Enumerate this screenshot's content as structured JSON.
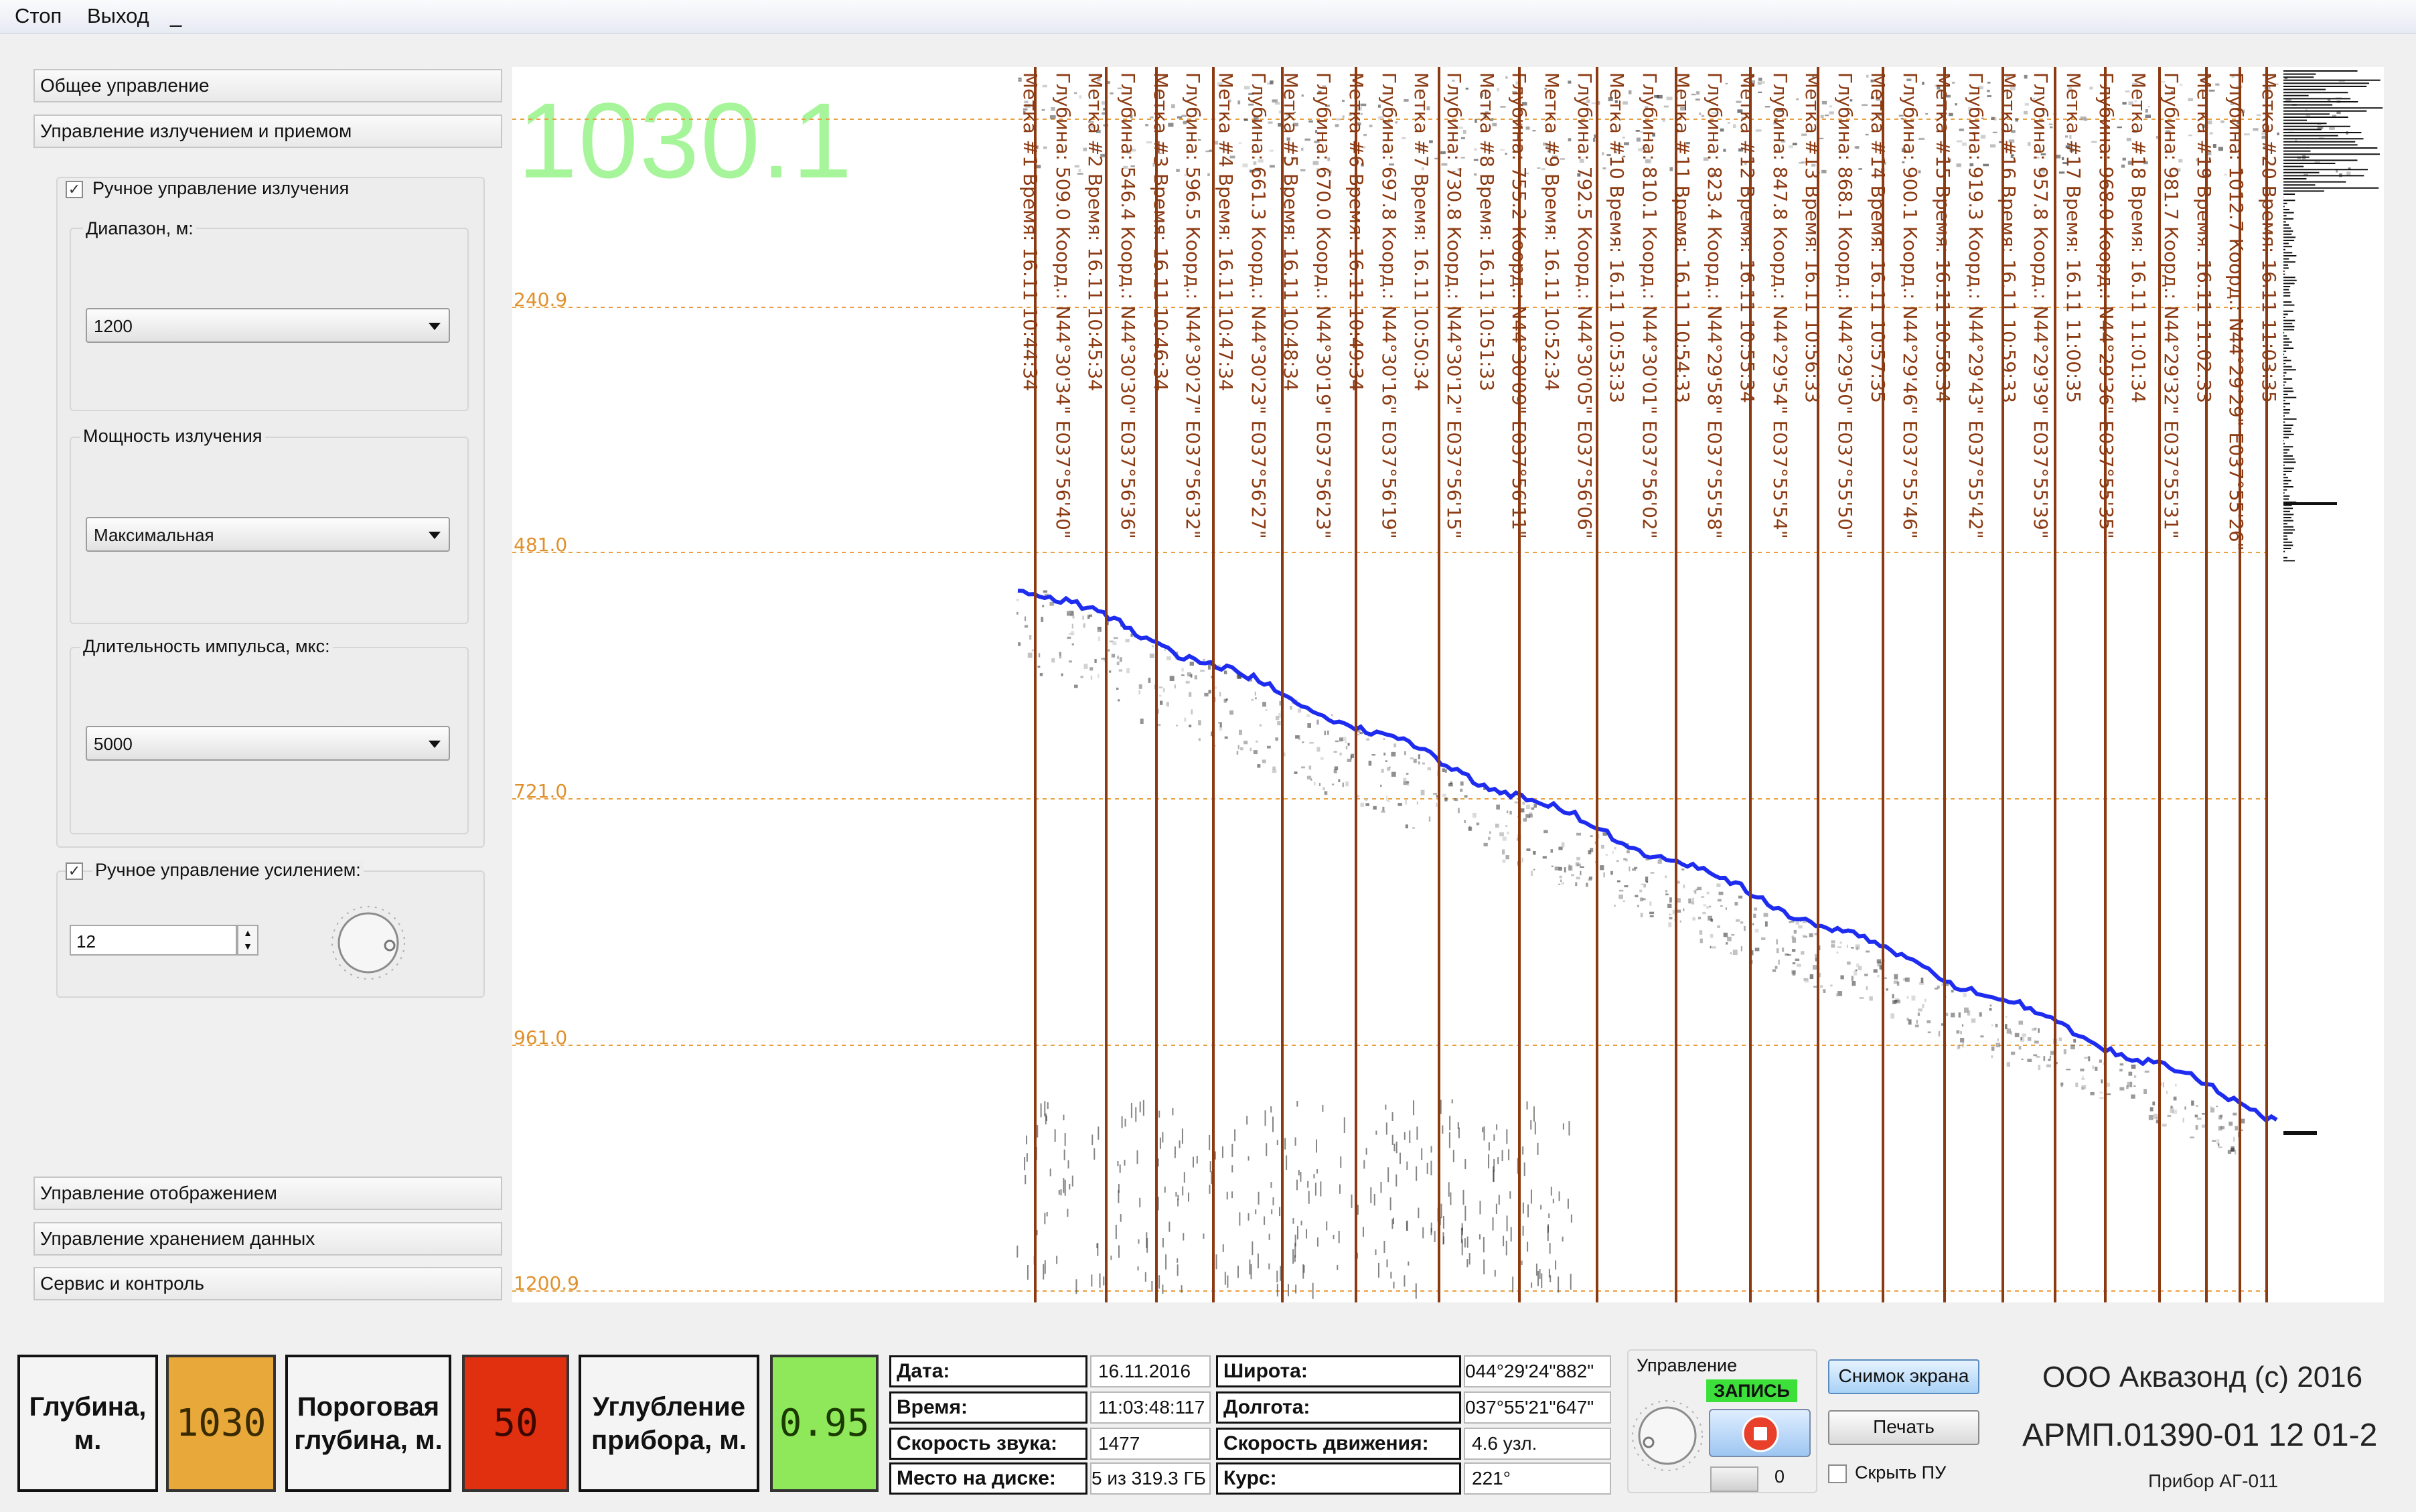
{
  "menu": {
    "stop": "Стоп",
    "exit": "Выход",
    "extra": "_"
  },
  "left_panel": {
    "general_control": "Общее управление",
    "emission_control": "Управление излучением и приемом",
    "manual_emission": "Ручное управление  излучения",
    "range_label": "Диапазон, м:",
    "range_value": "1200",
    "power_label": "Мощность излучения",
    "power_value": "Максимальная",
    "pulse_label": "Длительность импульса, мкс:",
    "pulse_value": "5000",
    "manual_gain": "Ручное управление усилением:",
    "gain_value": "12",
    "display_control": "Управление отображением",
    "storage_control": "Управление хранением данных",
    "service": "Сервис и контроль"
  },
  "echogram": {
    "current_depth": "1030.1",
    "depth_ticks": [
      "240.9",
      "481.0",
      "721.0",
      "961.0",
      "1200.9"
    ],
    "marks": [
      "Метка #1 Время: 16.11 10:44:34",
      "Глубина: 509.0 Коорд.: N44°30'34\" E037°56'40\"",
      "Метка #2 Время: 16.11 10:45:34",
      "Глубина: 546.4 Коорд.: N44°30'30\" E037°56'36\"",
      "Метка #3 Время: 16.11 10:46:34",
      "Глубина: 596.5 Коорд.: N44°30'27\" E037°56'32\"",
      "Метка #4 Время: 16.11 10:47:34",
      "Глубина: 661.3 Коорд.: N44°30'23\" E037°56'27\"",
      "Метка #5 Время: 16.11 10:48:34",
      "Глубина: 670.0 Коорд.: N44°30'19\" E037°56'23\"",
      "Метка #6 Время: 16.11 10:49:34",
      "Глубина: 697.8 Коорд.: N44°30'16\" E037°56'19\"",
      "Метка #7 Время: 16.11 10:50:34",
      "Глубина: 730.8 Коорд.: N44°30'12\" E037°56'15\"",
      "Метка #8 Время: 16.11 10:51:33",
      "Глубина: 755.2 Коорд.: N44°30'09\" E037°56'11\"",
      "Метка #9 Время: 16.11 10:52:34",
      "Глубина: 792.5 Коорд.: N44°30'05\" E037°56'06\"",
      "Метка #10 Время: 16.11 10:53:33",
      "Глубина: 810.1 Коорд.: N44°30'01\" E037°56'02\"",
      "Метка #11 Время: 16.11 10:54:33",
      "Глубина: 823.4 Коорд.: N44°29'58\" E037°55'58\"",
      "Метка #12 Время: 16.11 10:55:34",
      "Глубина: 847.8 Коорд.: N44°29'54\" E037°55'54\"",
      "Метка #13 Время: 16.11 10:56:33",
      "Глубина: 868.1 Коорд.: N44°29'50\" E037°55'50\"",
      "Метка #14 Время: 16.11 10:57:35",
      "Глубина: 900.1 Коорд.: N44°29'46\" E037°55'46\"",
      "Метка #15 Время: 16.11 10:58:34",
      "Глубина: 919.3 Коорд.: N44°29'43\" E037°55'42\"",
      "Метка #16 Время: 16.11 10:59:33",
      "Глубина: 957.8 Коорд.: N44°29'39\" E037°55'39\"",
      "Метка #17 Время: 16.11 11:00:35",
      "Глубина: 968.0 Коорд.: N44°29'36\" E037°55'35\"",
      "Метка #18 Время: 16.11 11:01:34",
      "Глубина: 981.7 Коорд.: N44°29'32\" E037°55'31\"",
      "Метка #19 Время: 16.11 11:02:33",
      "Глубина: 1012.7 Коорд.: N44°29'29\" E037°55'26\"",
      "Метка #20 Время: 16.11 11:03:35"
    ]
  },
  "bottom": {
    "depth_label": "Глубина, м.",
    "depth_value": "1030",
    "threshold_label": "Пороговая глубина, м.",
    "threshold_value": "50",
    "immersion_label": "Углубление прибора, м.",
    "immersion_value": "0.95",
    "date_label": "Дата:",
    "date_value": "16.11.2016",
    "time_label": "Время:",
    "time_value": "11:03:48:117",
    "sound_label": "Скорость звука:",
    "sound_value": "1477",
    "disk_label": "Место на диске:",
    "disk_value": "5 из 319.3 ГБ",
    "lat_label": "Широта:",
    "lat_value": "044°29'24\"882\"",
    "lon_label": "Долгота:",
    "lon_value": "037°55'21\"647\"",
    "speed_label": "Скорость движения:",
    "speed_value": "4.6 узл.",
    "course_label": "Курс:",
    "course_value": "221°",
    "control_label": "Управление",
    "record_label": "ЗАПИСЬ",
    "counter_value": "0",
    "snapshot_btn": "Снимок экрана",
    "print_btn": "Печать",
    "hide_pu": "Скрыть ПУ",
    "company": "ООО Аквазонд (с) 2016",
    "product_code": "АРМП.01390-01 12 01-2",
    "device": "Прибор АГ-011"
  },
  "colors": {
    "lcd_depth": "#e8a83a",
    "lcd_threshold": "#e03010",
    "lcd_immersion": "#8fe85a",
    "depth_text": "#a7f59a",
    "mark_line": "#8b3a12",
    "grid": "#e8a040",
    "track": "#1e2cf0"
  }
}
